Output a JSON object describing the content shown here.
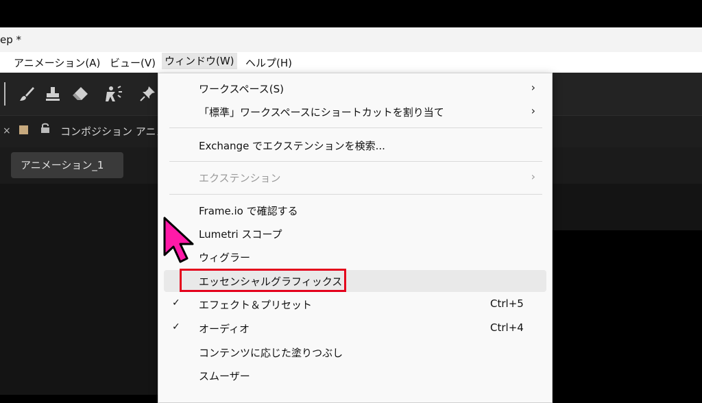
{
  "window": {
    "title": "ep *"
  },
  "menubar": {
    "items": [
      {
        "label": "アニメーション(A)"
      },
      {
        "label": "ビュー(V)"
      },
      {
        "label": "ウィンドウ(W)"
      },
      {
        "label": "ヘルプ(H)"
      }
    ]
  },
  "panel": {
    "close_glyph": "×",
    "composition_title": "コンポジション アニメ",
    "tab_label": "アニメーション_1"
  },
  "icons": {
    "tools": [
      "brush-icon",
      "stamp-icon",
      "eraser-icon",
      "puppet-icon",
      "pin-icon"
    ],
    "submenu": "chevron-right-icon",
    "check": "check-icon",
    "cursor": "arrow-cursor-icon"
  },
  "menu": {
    "items": [
      {
        "label": "ワークスペース(S)",
        "arrow": "›"
      },
      {
        "label": "「標準」ワークスペースにショートカットを割り当て",
        "arrow": "›"
      },
      {
        "label": "Exchange でエクステンションを検索..."
      },
      {
        "label": "エクステンション",
        "arrow": "›",
        "disabled": true
      },
      {
        "label": "Frame.io で確認する"
      },
      {
        "label": "Lumetri スコープ"
      },
      {
        "label": "ウィグラー"
      },
      {
        "label": "エッセンシャルグラフィックス"
      },
      {
        "label": "エフェクト＆プリセット",
        "check": "✓",
        "shortcut": "Ctrl+5"
      },
      {
        "label": "オーディオ",
        "check": "✓",
        "shortcut": "Ctrl+4"
      },
      {
        "label": "コンテンツに応じた塗りつぶし"
      },
      {
        "label": "スムーザー"
      }
    ]
  },
  "colors": {
    "highlight_box": "#e4001b",
    "cursor_fill": "#ff1aa8",
    "swatch": "#c7a97e"
  }
}
